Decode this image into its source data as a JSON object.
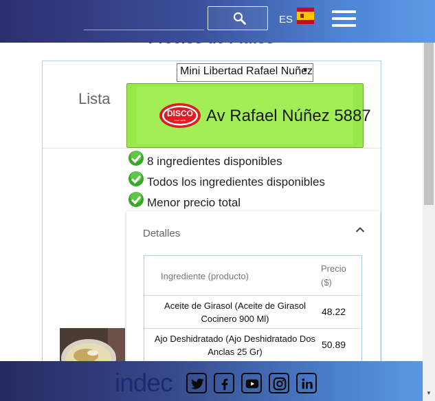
{
  "header": {
    "language": "ES"
  },
  "page": {
    "title": "Precios de Platos"
  },
  "store_select": {
    "selected": "Mini Libertad Rafael Nuñez"
  },
  "list_label": "Lista",
  "store_button": {
    "name": "Av Rafael Núñez 5887",
    "brand": "DISCO",
    "brand_tagline": "super rapido"
  },
  "checks": [
    "8 ingredientes disponibles",
    "Todos los ingredientes disponibles",
    "Menor precio total"
  ],
  "details": {
    "label": "Detalles",
    "columns": {
      "ingredient": "Ingrediente (producto)",
      "price": "Precio ($)"
    },
    "rows": [
      {
        "ingredient": "Aceite de Girasol (Aceite de Girasol Cocinero 900 Ml)",
        "price": "48.22"
      },
      {
        "ingredient": "Ajo Deshidratado (Ajo Deshidratado Dos Anclas 25 Gr)",
        "price": "50.89"
      }
    ]
  },
  "footer": {
    "logo": "indec"
  },
  "colors": {
    "header_start": "#2c2f6e",
    "header_end": "#5d99e6",
    "store_button": "#98e84b",
    "title_blue": "#2a3a8c"
  },
  "icons": [
    "search-icon",
    "spain-flag-icon",
    "menu-icon",
    "check-icon",
    "chevron-up-icon",
    "twitter-icon",
    "facebook-icon",
    "youtube-icon",
    "instagram-icon",
    "linkedin-icon"
  ]
}
